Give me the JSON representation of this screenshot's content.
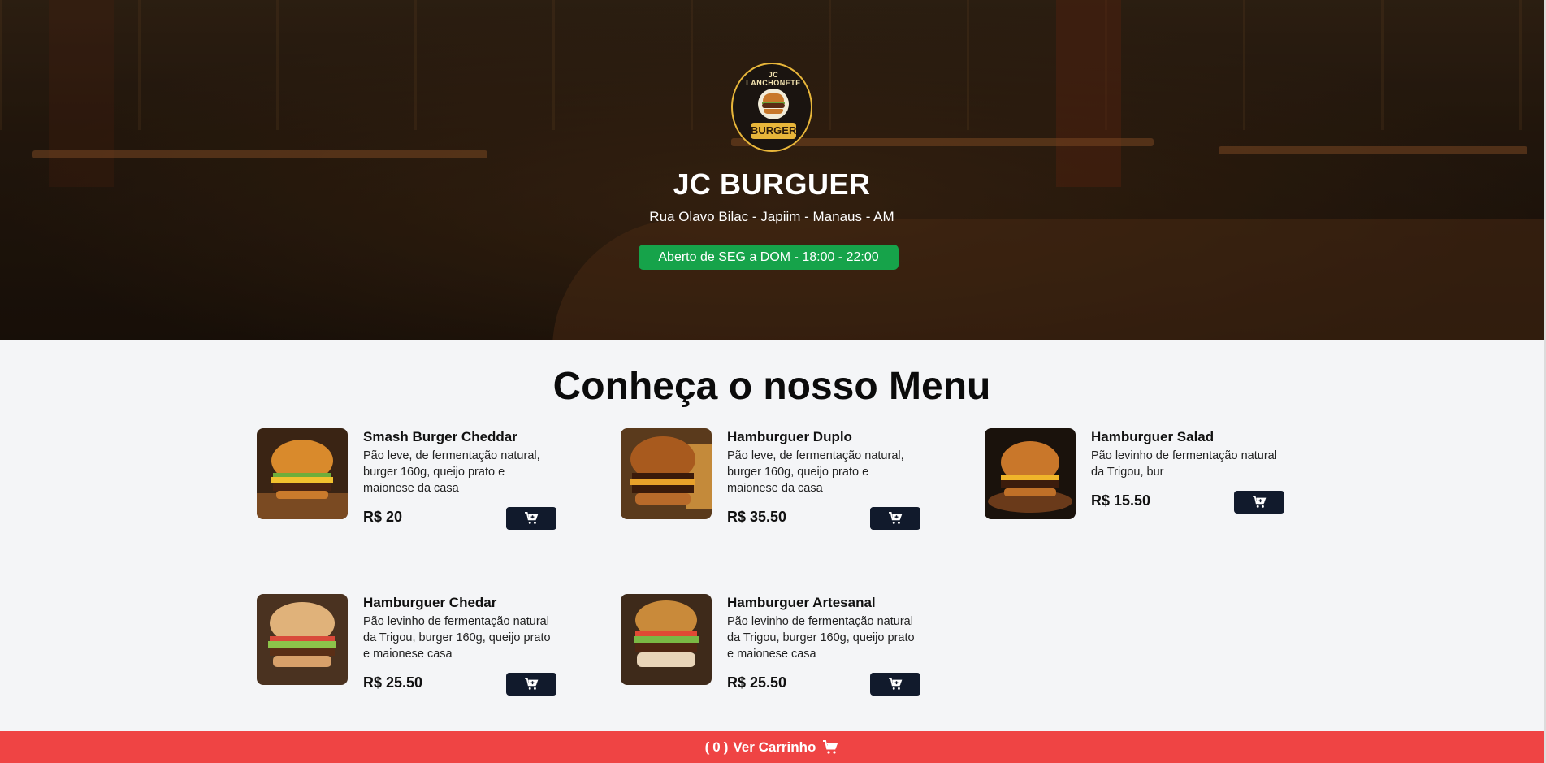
{
  "store": {
    "name": "JC BURGUER",
    "address": "Rua Olavo Bilac - Japiim - Manaus - AM",
    "hours": "Aberto de SEG a DOM - 18:00 - 22:00",
    "logo": {
      "ring_text": "JC LANCHONETE",
      "banner_text": "BURGER"
    }
  },
  "menu": {
    "title": "Conheça o nosso Menu",
    "items": [
      {
        "name": "Smash Burger Cheddar",
        "description": "Pão leve, de fermentação natural, burger 160g, queijo prato e maionese da casa",
        "price": "R$ 20"
      },
      {
        "name": "Hamburguer Duplo",
        "description": "Pão leve, de fermentação natural, burger 160g, queijo prato e maionese da casa",
        "price": "R$ 35.50"
      },
      {
        "name": "Hamburguer Salad",
        "description": "Pão levinho de fermentação natural da Trigou, bur",
        "price": "R$ 15.50"
      },
      {
        "name": "Hamburguer Chedar",
        "description": "Pão levinho de fermentação natural da Trigou, burger 160g, queijo prato e maionese casa",
        "price": "R$ 25.50"
      },
      {
        "name": "Hamburguer Artesanal",
        "description": "Pão levinho de fermentação natural da Trigou, burger 160g, queijo prato e maionese casa",
        "price": "R$ 25.50"
      }
    ]
  },
  "cart": {
    "open_paren": "(",
    "count": "0",
    "close_paren": ")",
    "label": "Ver Carrinho"
  },
  "icons": {
    "add_to_cart": "cart-plus-icon",
    "cart": "cart-icon"
  },
  "colors": {
    "open_badge": "#16a34a",
    "cart_bar": "#ef4444",
    "button": "#111a2c"
  }
}
